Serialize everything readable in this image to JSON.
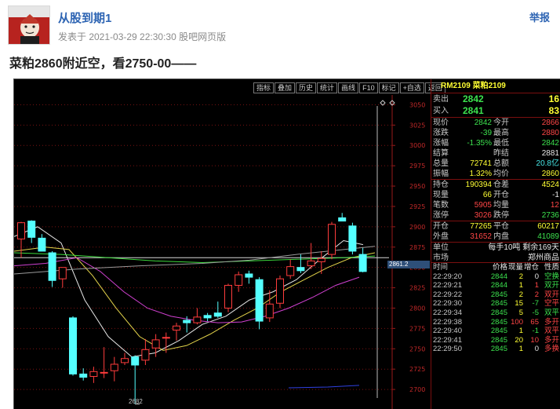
{
  "post": {
    "author": "从股到期1",
    "meta": "发表于 2021-03-29 22:30:30 股吧网页版",
    "report": "举报",
    "title": "菜粕2860附近空，看2750-00——"
  },
  "toolbar": [
    "指标",
    "叠加",
    "历史",
    "统计",
    "画线",
    "F10",
    "标记",
    "+自选",
    "返回"
  ],
  "chart": {
    "price_tag": "2861.2",
    "low_label": "2682",
    "grid_style": "dotted",
    "y_axis_ticks": [
      3050,
      3025,
      3000,
      2975,
      2950,
      2925,
      2900,
      2875,
      2850,
      2825,
      2800,
      2775,
      2750,
      2725,
      2700
    ],
    "up_color": "#ff3c3c",
    "down_color": "#54ffff"
  },
  "chart_data": {
    "type": "candlestick",
    "title": "",
    "ylim": [
      2675,
      3062
    ],
    "ohlc_approx": [
      {
        "o": 2885,
        "h": 2906,
        "l": 2862,
        "c": 2905
      },
      {
        "o": 2907,
        "h": 2908,
        "l": 2880,
        "c": 2887
      },
      {
        "o": 2886,
        "h": 2891,
        "l": 2870,
        "c": 2870
      },
      {
        "o": 2868,
        "h": 2870,
        "l": 2826,
        "c": 2834
      },
      {
        "o": 2836,
        "h": 2850,
        "l": 2825,
        "c": 2850
      },
      {
        "o": 2788,
        "h": 2790,
        "l": 2717,
        "c": 2719
      },
      {
        "o": 2719,
        "h": 2726,
        "l": 2711,
        "c": 2715
      },
      {
        "o": 2716,
        "h": 2728,
        "l": 2708,
        "c": 2722
      },
      {
        "o": 2721,
        "h": 2752,
        "l": 2714,
        "c": 2721
      },
      {
        "o": 2723,
        "h": 2740,
        "l": 2710,
        "c": 2731
      },
      {
        "o": 2733,
        "h": 2745,
        "l": 2730,
        "c": 2738
      },
      {
        "o": 2740,
        "h": 2742,
        "l": 2682,
        "c": 2730
      },
      {
        "o": 2736,
        "h": 2762,
        "l": 2730,
        "c": 2749
      },
      {
        "o": 2751,
        "h": 2768,
        "l": 2740,
        "c": 2761
      },
      {
        "o": 2764,
        "h": 2770,
        "l": 2745,
        "c": 2764
      },
      {
        "o": 2773,
        "h": 2782,
        "l": 2760,
        "c": 2778
      },
      {
        "o": 2785,
        "h": 2790,
        "l": 2770,
        "c": 2782
      },
      {
        "o": 2782,
        "h": 2800,
        "l": 2780,
        "c": 2789
      },
      {
        "o": 2791,
        "h": 2794,
        "l": 2784,
        "c": 2788
      },
      {
        "o": 2794,
        "h": 2808,
        "l": 2788,
        "c": 2790
      },
      {
        "o": 2800,
        "h": 2830,
        "l": 2795,
        "c": 2828
      },
      {
        "o": 2828,
        "h": 2845,
        "l": 2820,
        "c": 2841
      },
      {
        "o": 2842,
        "h": 2846,
        "l": 2830,
        "c": 2838
      },
      {
        "o": 2835,
        "h": 2838,
        "l": 2774,
        "c": 2784
      },
      {
        "o": 2788,
        "h": 2822,
        "l": 2783,
        "c": 2805
      },
      {
        "o": 2806,
        "h": 2840,
        "l": 2800,
        "c": 2836
      },
      {
        "o": 2840,
        "h": 2860,
        "l": 2836,
        "c": 2851
      },
      {
        "o": 2850,
        "h": 2866,
        "l": 2843,
        "c": 2846
      },
      {
        "o": 2852,
        "h": 2880,
        "l": 2848,
        "c": 2858
      },
      {
        "o": 2857,
        "h": 2870,
        "l": 2842,
        "c": 2861
      },
      {
        "o": 2866,
        "h": 2906,
        "l": 2860,
        "c": 2903
      },
      {
        "o": 2911,
        "h": 2917,
        "l": 2907,
        "c": 2907
      },
      {
        "o": 2901,
        "h": 2905,
        "l": 2866,
        "c": 2870
      },
      {
        "o": 2866,
        "h": 2874,
        "l": 2844,
        "c": 2845
      }
    ]
  },
  "quote": {
    "code": "RM2109 菜粕2109",
    "ask": {
      "label": "卖出",
      "price": "2842",
      "vol": "16"
    },
    "bid": {
      "label": "买入",
      "price": "2841",
      "vol": "83"
    },
    "rows1": [
      {
        "l1": "现价",
        "v1": "2842",
        "c1": "green",
        "l2": "今开",
        "v2": "2866",
        "c2": "red"
      },
      {
        "l1": "涨跌",
        "v1": "-39",
        "c1": "green",
        "l2": "最高",
        "v2": "2880",
        "c2": "red"
      },
      {
        "l1": "涨幅",
        "v1": "-1.35%",
        "c1": "green",
        "l2": "最低",
        "v2": "2842",
        "c2": "green"
      },
      {
        "l1": "结算",
        "v1": "",
        "c1": "white",
        "l2": "昨结",
        "v2": "2881",
        "c2": "white"
      },
      {
        "l1": "总量",
        "v1": "72741",
        "c1": "yellow",
        "l2": "总额",
        "v2": "20.8亿",
        "c2": "cyan"
      },
      {
        "l1": "振幅",
        "v1": "1.32%",
        "c1": "yellow",
        "l2": "均价",
        "v2": "2860",
        "c2": "yellow"
      }
    ],
    "rows2": [
      {
        "l1": "持仓",
        "v1": "190394",
        "c1": "yellow",
        "l2": "仓差",
        "v2": "4524",
        "c2": "yellow"
      },
      {
        "l1": "现量",
        "v1": "66",
        "c1": "yellow",
        "l2": "开仓",
        "v2": "-1",
        "c2": "white"
      },
      {
        "l1": "笔数",
        "v1": "5905",
        "c1": "red",
        "l2": "均量",
        "v2": "12",
        "c2": "red"
      },
      {
        "l1": "涨停",
        "v1": "3026",
        "c1": "red",
        "l2": "跌停",
        "v2": "2736",
        "c2": "green"
      }
    ],
    "rows3": [
      {
        "l1": "开仓",
        "v1": "77265",
        "c1": "yellow",
        "l2": "平仓",
        "v2": "60217",
        "c2": "yellow"
      },
      {
        "l1": "外盘",
        "v1": "31652",
        "c1": "red",
        "l2": "内盘",
        "v2": "41089",
        "c2": "green"
      }
    ],
    "unit": {
      "label": "单位",
      "value": "每手10吨 剩余169天"
    },
    "market": {
      "label": "市场",
      "value": "郑州商品"
    },
    "ticks_header": {
      "time": "时间",
      "price": "价格",
      "vol": "现量",
      "oi": "增仓",
      "nature": "性质"
    },
    "ticks": [
      {
        "time": "22:29:20",
        "price": "2844",
        "vol": "2",
        "oi": "0",
        "nature": "空换",
        "pc": "green",
        "vc": "yellow",
        "oc": "white",
        "nc": "green"
      },
      {
        "time": "22:29:21",
        "price": "2844",
        "vol": "1",
        "oi": "1",
        "nature": "双开",
        "pc": "green",
        "vc": "yellow",
        "oc": "red",
        "nc": "green"
      },
      {
        "time": "22:29:22",
        "price": "2845",
        "vol": "2",
        "oi": "2",
        "nature": "双开",
        "pc": "green",
        "vc": "yellow",
        "oc": "red",
        "nc": "red"
      },
      {
        "time": "22:29:30",
        "price": "2845",
        "vol": "15",
        "oi": "-7",
        "nature": "空平",
        "pc": "green",
        "vc": "yellow",
        "oc": "green",
        "nc": "red"
      },
      {
        "time": "22:29:34",
        "price": "2845",
        "vol": "5",
        "oi": "-5",
        "nature": "双平",
        "pc": "green",
        "vc": "yellow",
        "oc": "green",
        "nc": "green"
      },
      {
        "time": "22:29:38",
        "price": "2845",
        "vol": "100",
        "oi": "65",
        "nature": "多开",
        "pc": "green",
        "vc": "red",
        "oc": "red",
        "nc": "red"
      },
      {
        "time": "22:29:40",
        "price": "2845",
        "vol": "1",
        "oi": "-1",
        "nature": "双平",
        "pc": "green",
        "vc": "yellow",
        "oc": "green",
        "nc": "red"
      },
      {
        "time": "22:29:41",
        "price": "2845",
        "vol": "20",
        "oi": "10",
        "nature": "多开",
        "pc": "green",
        "vc": "yellow",
        "oc": "red",
        "nc": "red"
      },
      {
        "time": "22:29:50",
        "price": "2845",
        "vol": "1",
        "oi": "0",
        "nature": "多换",
        "pc": "green",
        "vc": "yellow",
        "oc": "white",
        "nc": "red"
      }
    ]
  }
}
